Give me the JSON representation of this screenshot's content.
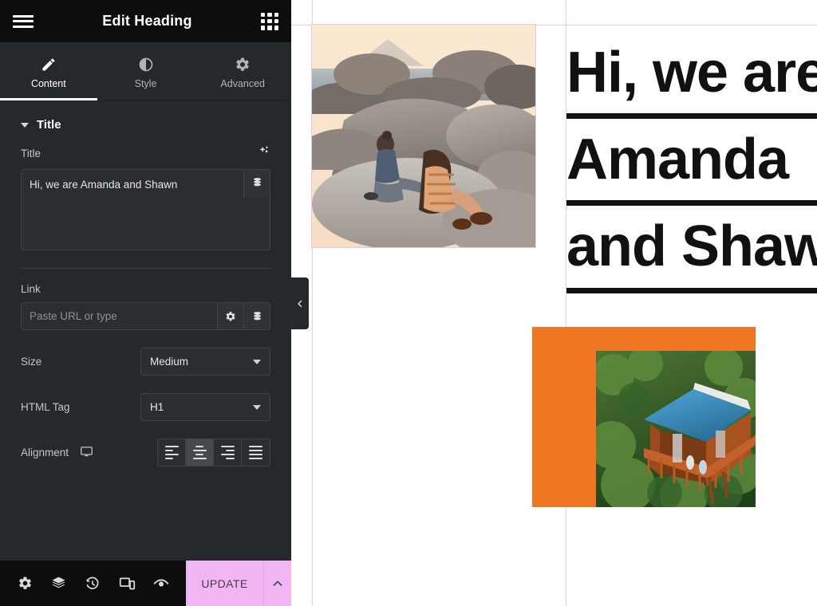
{
  "panel": {
    "header": {
      "menu_icon": "hamburger-icon",
      "title": "Edit Heading",
      "widgets_icon": "grid-widgets-icon"
    },
    "tabs": [
      {
        "label": "Content",
        "icon": "pencil-icon",
        "active": true
      },
      {
        "label": "Style",
        "icon": "contrast-half-circle-icon",
        "active": false
      },
      {
        "label": "Advanced",
        "icon": "gear-icon",
        "active": false
      }
    ],
    "section": {
      "label": "Title",
      "collapsed": false,
      "caret_icon": "caret-down-icon"
    },
    "controls": {
      "title": {
        "label": "Title",
        "ai_icon": "ai-sparkle-icon",
        "value": "Hi, we are Amanda and Shawn",
        "dynamic_icon": "dynamic-tags-database-icon"
      },
      "link": {
        "label": "Link",
        "value": "",
        "placeholder": "Paste URL or type",
        "options_icon": "gear-icon",
        "dynamic_icon": "dynamic-tags-database-icon"
      },
      "size": {
        "label": "Size",
        "value": "Medium",
        "arrow_icon": "chevron-down-icon"
      },
      "html_tag": {
        "label": "HTML Tag",
        "value": "H1",
        "arrow_icon": "chevron-down-icon"
      },
      "alignment": {
        "label": "Alignment",
        "device_icon": "desktop-monitor-icon",
        "options": [
          {
            "name": "align-left",
            "active": false
          },
          {
            "name": "align-center",
            "active": true
          },
          {
            "name": "align-right",
            "active": false
          },
          {
            "name": "align-justify",
            "active": false
          }
        ]
      }
    },
    "footer": {
      "icons": [
        {
          "name": "settings-gear-icon"
        },
        {
          "name": "navigator-layers-icon"
        },
        {
          "name": "history-clock-icon"
        },
        {
          "name": "responsive-mode-icon"
        },
        {
          "name": "preview-eye-icon"
        }
      ],
      "update_label": "UPDATE",
      "update_caret_icon": "chevron-up-icon",
      "update_color": "#f2b6f5"
    },
    "collapse_handle": {
      "icon": "chevron-left-icon"
    },
    "colors": {
      "panel_bg": "#26292c",
      "header_bg": "#0d0d0d",
      "accent": "#f2b6f5"
    }
  },
  "canvas": {
    "guides_color": "#f0c8f2",
    "heading": {
      "lines": [
        "Hi, we are",
        "Amanda",
        "and Shawn"
      ],
      "tag": "H1",
      "underlined": true
    },
    "media": [
      {
        "name": "couple-on-rocks-photo",
        "alt": "Couple sitting on granite boulders by the sea at sunset"
      },
      {
        "name": "treehouse-photo",
        "alt": "Aerial view of a wooden treehouse cabin with blue roof in the forest",
        "backdrop_color": "#ef7622"
      }
    ]
  }
}
